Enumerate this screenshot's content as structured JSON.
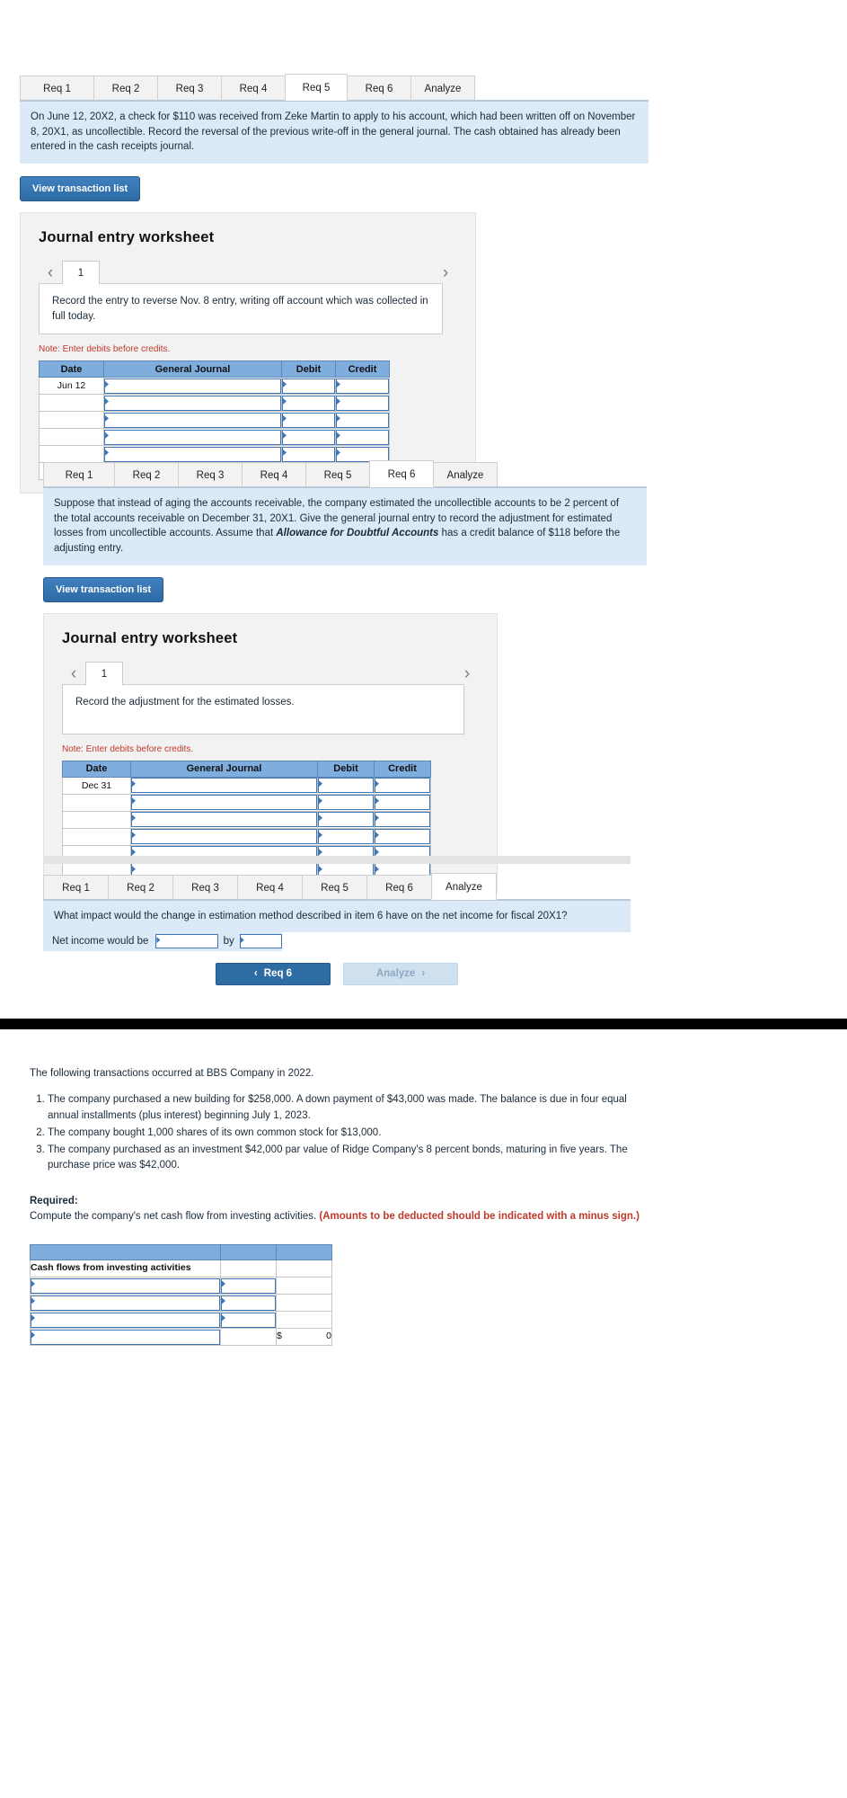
{
  "tabs": [
    "Req 1",
    "Req 2",
    "Req 3",
    "Req 4",
    "Req 5",
    "Req 6",
    "Analyze"
  ],
  "colors": {
    "accent": "#2e6da4",
    "prompt_bg": "#dceaf7",
    "table_header": "#7fadde",
    "note_red": "#c0392b"
  },
  "req5": {
    "active_tab": "Req 5",
    "prompt": "On June 12, 20X2, a check for $110 was received from Zeke Martin to apply to his account, which had been written off on November 8, 20X1, as uncollectible. Record the reversal of the previous write-off in the general journal. The cash obtained has already been entered in the cash receipts journal.",
    "view_transaction_list": "View transaction list",
    "worksheet_title": "Journal entry worksheet",
    "page_tab": "1",
    "entry_description": "Record the entry to reverse Nov. 8 entry, writing off account which was collected in full today.",
    "note": "Note: Enter debits before credits.",
    "table": {
      "headers": [
        "Date",
        "General Journal",
        "Debit",
        "Credit"
      ],
      "rows": [
        {
          "date": "Jun 12",
          "journal": "",
          "debit": "",
          "credit": ""
        },
        {
          "date": "",
          "journal": "",
          "debit": "",
          "credit": ""
        },
        {
          "date": "",
          "journal": "",
          "debit": "",
          "credit": ""
        },
        {
          "date": "",
          "journal": "",
          "debit": "",
          "credit": ""
        },
        {
          "date": "",
          "journal": "",
          "debit": "",
          "credit": ""
        },
        {
          "date": "",
          "journal": "",
          "debit": "",
          "credit": ""
        }
      ]
    }
  },
  "req6": {
    "active_tab": "Req 6",
    "prompt_part1": "Suppose that instead of aging the accounts receivable, the company estimated the uncollectible accounts to be 2 percent of the total accounts receivable on December 31, 20X1. Give the general journal entry to record the adjustment for estimated losses from uncollectible accounts. Assume that ",
    "prompt_emphasis": "Allowance for Doubtful Accounts",
    "prompt_part2": " has a credit balance of $118 before the adjusting entry.",
    "view_transaction_list": "View transaction list",
    "worksheet_title": "Journal entry worksheet",
    "page_tab": "1",
    "entry_description": "Record the adjustment for the estimated losses.",
    "note": "Note: Enter debits before credits.",
    "table": {
      "headers": [
        "Date",
        "General Journal",
        "Debit",
        "Credit"
      ],
      "rows": [
        {
          "date": "Dec 31",
          "journal": "",
          "debit": "",
          "credit": ""
        },
        {
          "date": "",
          "journal": "",
          "debit": "",
          "credit": ""
        },
        {
          "date": "",
          "journal": "",
          "debit": "",
          "credit": ""
        },
        {
          "date": "",
          "journal": "",
          "debit": "",
          "credit": ""
        },
        {
          "date": "",
          "journal": "",
          "debit": "",
          "credit": ""
        },
        {
          "date": "",
          "journal": "",
          "debit": "",
          "credit": ""
        }
      ]
    }
  },
  "analyze": {
    "active_tab": "Analyze",
    "prompt": "What impact would the change in estimation method described in item 6 have on the net income for fiscal 20X1?",
    "row_label": "Net income would be",
    "row_value": "",
    "by_label": "by",
    "by_value": "",
    "prev_button": "Req 6",
    "next_button": "Analyze",
    "prev_icon": "chevron-left-icon",
    "next_icon": "chevron-right-icon"
  },
  "bottom_problem": {
    "intro": "The following transactions occurred at BBS Company in 2022.",
    "items": [
      "The company purchased a new building for $258,000. A down payment of $43,000 was made. The balance is due in four equal annual installments (plus interest) beginning July 1, 2023.",
      "The company bought 1,000 shares of its own common stock for $13,000.",
      "The company purchased as an investment $42,000 par value of Ridge Company's 8 percent bonds, maturing in five years. The purchase price was $42,000."
    ],
    "required_label": "Required:",
    "required_text": "Compute the company's net cash flow from investing activities. ",
    "required_note": "(Amounts to be deducted should be indicated with a minus sign.)",
    "table": {
      "label": "Cash flows from investing activities",
      "rows": [
        {
          "label": "",
          "col2": "",
          "col3": ""
        },
        {
          "label": "",
          "col2": "",
          "col3": ""
        },
        {
          "label": "",
          "col2": "",
          "col3": ""
        }
      ],
      "total": {
        "label": "",
        "dollar": "$",
        "amount": "0"
      }
    }
  }
}
